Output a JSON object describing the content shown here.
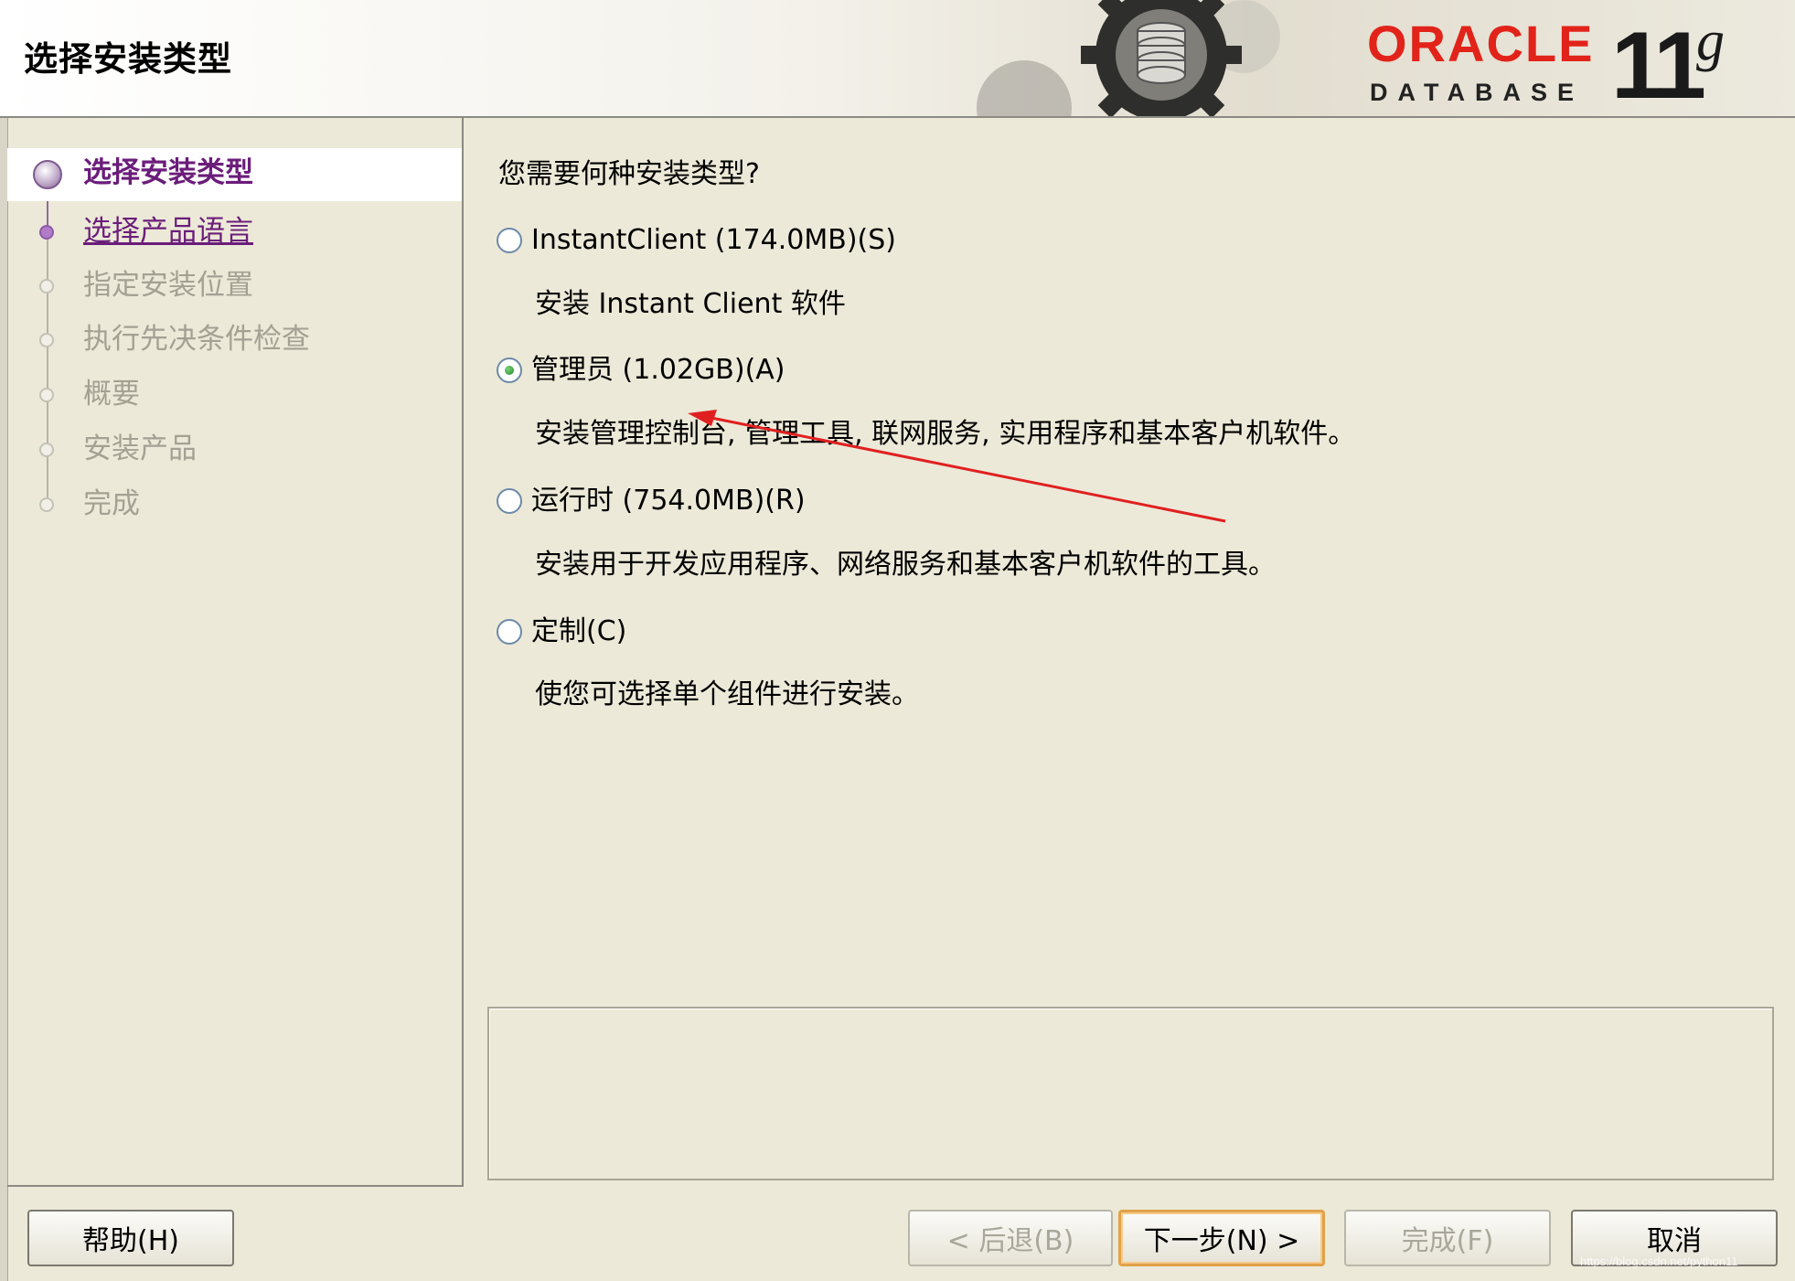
{
  "header": {
    "title": "选择安装类型",
    "brand_name": "ORACLE",
    "brand_sub": "DATABASE",
    "version": "11",
    "version_suffix": "g"
  },
  "sidebar": {
    "steps": [
      {
        "label": "选择安装类型",
        "state": "current"
      },
      {
        "label": "选择产品语言",
        "state": "link"
      },
      {
        "label": "指定安装位置",
        "state": "disabled"
      },
      {
        "label": "执行先决条件检查",
        "state": "disabled"
      },
      {
        "label": "概要",
        "state": "disabled"
      },
      {
        "label": "安装产品",
        "state": "disabled"
      },
      {
        "label": "完成",
        "state": "disabled"
      }
    ]
  },
  "main": {
    "question": "您需要何种安装类型?",
    "options": [
      {
        "label": "InstantClient (174.0MB)(S)",
        "description": "安装 Instant Client 软件",
        "checked": false
      },
      {
        "label": "管理员 (1.02GB)(A)",
        "description": "安装管理控制台, 管理工具, 联网服务, 实用程序和基本客户机软件。",
        "checked": true
      },
      {
        "label": "运行时 (754.0MB)(R)",
        "description": "安装用于开发应用程序、网络服务和基本客户机软件的工具。",
        "checked": false
      },
      {
        "label": "定制(C)",
        "description": "使您可选择单个组件进行安装。",
        "checked": false
      }
    ]
  },
  "footer": {
    "help": "帮助(H)",
    "back": "< 后退(B)",
    "next": "下一步(N) >",
    "finish": "完成(F)",
    "cancel": "取消"
  },
  "watermark": "https://blog.csdn.net/python11",
  "colors": {
    "background": "#ece9d8",
    "accent_purple": "#6b1d7a",
    "oracle_red": "#e2231a",
    "annotation_arrow": "#e02020"
  }
}
